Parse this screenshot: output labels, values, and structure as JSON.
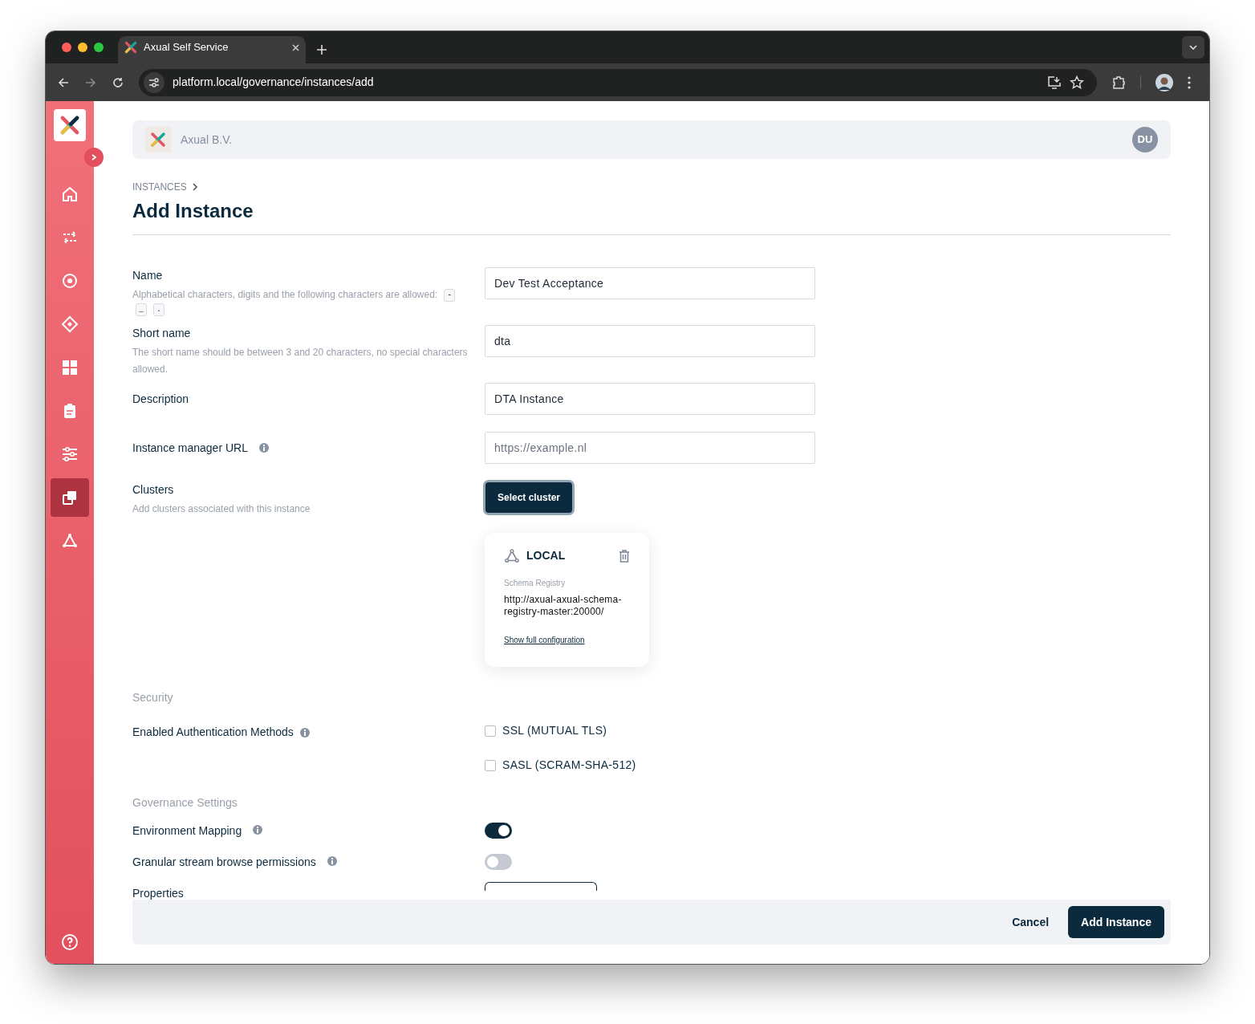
{
  "browser": {
    "tab_title": "Axual Self Service",
    "url": "platform.local/governance/instances/add"
  },
  "sidebar": {
    "items": [
      {
        "kind": "home",
        "selected": false
      },
      {
        "kind": "transfer",
        "selected": false
      },
      {
        "kind": "target",
        "selected": false
      },
      {
        "kind": "diamond",
        "selected": false
      },
      {
        "kind": "grid",
        "selected": false
      },
      {
        "kind": "clipboard",
        "selected": false
      },
      {
        "kind": "sliders",
        "selected": false
      },
      {
        "kind": "copy",
        "selected": true
      },
      {
        "kind": "network",
        "selected": false
      }
    ]
  },
  "header": {
    "organization": "Axual B.V.",
    "avatar": "DU"
  },
  "breadcrumb": "INSTANCES",
  "title": "Add Instance",
  "fields": [
    {
      "label": "Name",
      "hint": "Alphabetical characters, digits and the following characters are allowed:",
      "chips": [
        "-",
        "_",
        "."
      ],
      "value": "Dev Test Acceptance"
    },
    {
      "label": "Short name",
      "hint": "The short name should be between 3 and 20 characters, no special characters allowed.",
      "value": "dta"
    },
    {
      "label": "Description",
      "value": "DTA Instance"
    },
    {
      "label": "Instance manager URL",
      "info": true,
      "placeholder": "https://example.nl"
    }
  ],
  "clusters": {
    "label": "Clusters",
    "hint": "Add clusters associated with this instance",
    "button": "Select cluster",
    "cards": [
      {
        "name": "LOCAL",
        "registry_label": "Schema Registry",
        "registry_url": "http://axual-axual-schema-registry-master:20000/",
        "link": "Show full configuration"
      }
    ]
  },
  "security": {
    "title": "Security",
    "label": "Enabled Authentication Methods",
    "options": [
      {
        "label": "SSL (MUTUAL TLS)",
        "checked": false
      },
      {
        "label": "SASL (SCRAM-SHA-512)",
        "checked": false
      }
    ]
  },
  "governance": {
    "title": "Governance Settings",
    "toggles": [
      {
        "label": "Environment Mapping",
        "on": true
      },
      {
        "label": "Granular stream browse permissions",
        "on": false
      }
    ]
  },
  "properties": {
    "label": "Properties"
  },
  "footer": {
    "cancel": "Cancel",
    "submit": "Add Instance"
  }
}
